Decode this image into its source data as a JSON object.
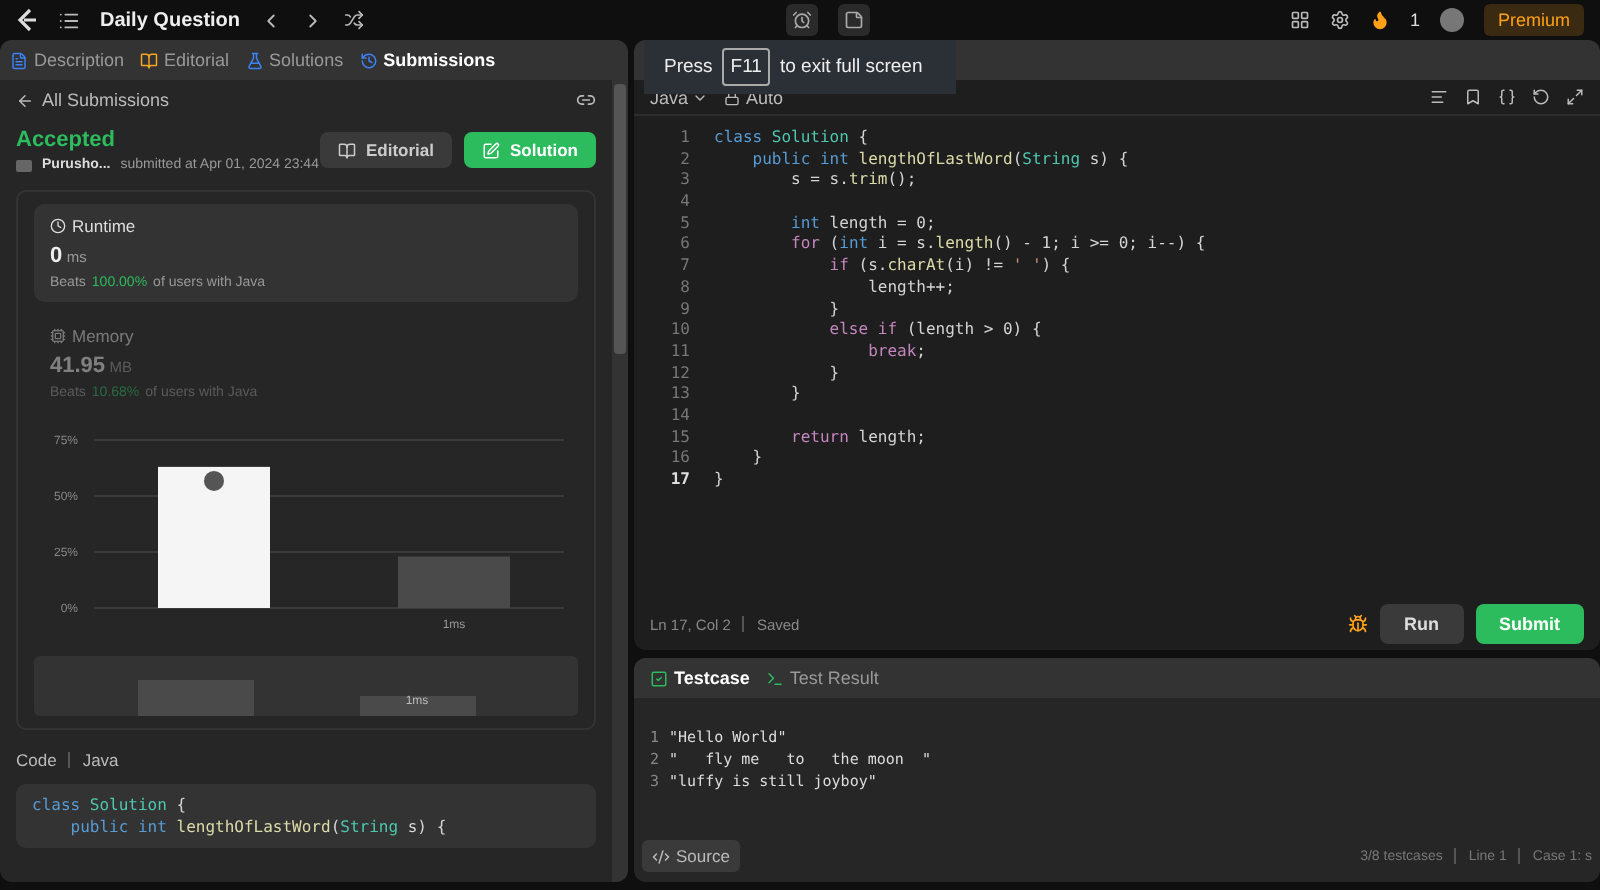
{
  "top_bar": {
    "title": "Daily Question",
    "streak": "1",
    "premium": "Premium"
  },
  "fullscreen_tip": {
    "before": "Press",
    "key": "F11",
    "after": "to exit full screen"
  },
  "tabs": [
    {
      "label": "Description",
      "kind": "description",
      "selected": false
    },
    {
      "label": "Editorial",
      "kind": "editorial",
      "selected": false
    },
    {
      "label": "Solutions",
      "kind": "solutions",
      "selected": false
    },
    {
      "label": "Submissions",
      "kind": "submissions",
      "selected": true
    }
  ],
  "submission": {
    "back": "All Submissions",
    "status": "Accepted",
    "user": "Purusho...",
    "submitted": "submitted at Apr 01, 2024 23:44",
    "buttons": [
      {
        "label": "Editorial",
        "kind": "secondary"
      },
      {
        "label": "Solution",
        "kind": "primary"
      }
    ],
    "stats": [
      {
        "kind": "runtime",
        "title": "Runtime",
        "value": "0",
        "unit": "ms",
        "beats": "Beats",
        "percent": "100.00%",
        "rest": "of users with Java",
        "selected": true
      },
      {
        "kind": "memory",
        "title": "Memory",
        "value": "41.95",
        "unit": "MB",
        "beats": "Beats",
        "percent": "10.68%",
        "rest": "of users with Java",
        "selected": false
      }
    ],
    "chart_data": {
      "type": "bar",
      "values": [
        63,
        23
      ],
      "ylim": [
        0,
        75
      ],
      "yticks": [
        {
          "value": 0,
          "label": "0%"
        },
        {
          "value": 25,
          "label": "25%"
        },
        {
          "value": 50,
          "label": "50%"
        },
        {
          "value": 75,
          "label": "75%"
        }
      ],
      "annotations": [
        "1ms"
      ]
    },
    "overview": {
      "label": "1ms"
    },
    "code_label": "Code",
    "code_lang": "Java",
    "code_preview": [
      {
        "tokens": [
          {
            "text": "class ",
            "kind": "kw"
          },
          {
            "text": "Solution",
            "kind": "type"
          },
          {
            "text": " {",
            "kind": "plain"
          }
        ]
      },
      {
        "tokens": [
          {
            "text": "    public int ",
            "kind": "kw"
          },
          {
            "text": "lengthOfLastWord",
            "kind": "fn"
          },
          {
            "text": "(",
            "kind": "plain"
          },
          {
            "text": "String",
            "kind": "type"
          },
          {
            "text": " s) {",
            "kind": "plain"
          }
        ]
      }
    ]
  },
  "editor": {
    "language": "Java",
    "mode": "Auto",
    "lines": [
      {
        "number": "1",
        "current": false,
        "tokens": [
          {
            "text": "class ",
            "kind": "kw"
          },
          {
            "text": "Solution",
            "kind": "type"
          },
          {
            "text": " {",
            "kind": "plain"
          }
        ]
      },
      {
        "number": "2",
        "current": false,
        "tokens": [
          {
            "text": "    public int ",
            "kind": "kw"
          },
          {
            "text": "lengthOfLastWord",
            "kind": "fn"
          },
          {
            "text": "(",
            "kind": "plain"
          },
          {
            "text": "String",
            "kind": "type"
          },
          {
            "text": " s) {",
            "kind": "plain"
          }
        ]
      },
      {
        "number": "3",
        "current": false,
        "tokens": [
          {
            "text": "        s = s.",
            "kind": "plain"
          },
          {
            "text": "trim",
            "kind": "fn"
          },
          {
            "text": "();",
            "kind": "plain"
          }
        ]
      },
      {
        "number": "4",
        "current": false
      },
      {
        "number": "5",
        "current": false,
        "tokens": [
          {
            "text": "        int ",
            "kind": "kw"
          },
          {
            "text": "length = 0;",
            "kind": "plain"
          }
        ]
      },
      {
        "number": "6",
        "current": false,
        "tokens": [
          {
            "text": "        for ",
            "kind": "ctrl"
          },
          {
            "text": "(",
            "kind": "plain"
          },
          {
            "text": "int ",
            "kind": "kw"
          },
          {
            "text": "i = s.",
            "kind": "plain"
          },
          {
            "text": "length",
            "kind": "fn"
          },
          {
            "text": "() - 1; i >= 0; i--) {",
            "kind": "plain"
          }
        ]
      },
      {
        "number": "7",
        "current": false,
        "tokens": [
          {
            "text": "            if ",
            "kind": "ctrl"
          },
          {
            "text": "(s.",
            "kind": "plain"
          },
          {
            "text": "charAt",
            "kind": "fn"
          },
          {
            "text": "(i) != ",
            "kind": "plain"
          },
          {
            "text": "' '",
            "kind": "str"
          },
          {
            "text": ") {",
            "kind": "plain"
          }
        ]
      },
      {
        "number": "8",
        "current": false,
        "tokens": [
          {
            "text": "                length++;",
            "kind": "plain"
          }
        ]
      },
      {
        "number": "9",
        "current": false,
        "tokens": [
          {
            "text": "            }",
            "kind": "plain"
          }
        ]
      },
      {
        "number": "10",
        "current": false,
        "tokens": [
          {
            "text": "            else if ",
            "kind": "ctrl"
          },
          {
            "text": "(length > 0) {",
            "kind": "plain"
          }
        ]
      },
      {
        "number": "11",
        "current": false,
        "tokens": [
          {
            "text": "                break",
            "kind": "ctrl"
          },
          {
            "text": ";",
            "kind": "plain"
          }
        ]
      },
      {
        "number": "12",
        "current": false,
        "tokens": [
          {
            "text": "            }",
            "kind": "plain"
          }
        ]
      },
      {
        "number": "13",
        "current": false,
        "tokens": [
          {
            "text": "        }",
            "kind": "plain"
          }
        ]
      },
      {
        "number": "14",
        "current": false
      },
      {
        "number": "15",
        "current": false,
        "tokens": [
          {
            "text": "        return ",
            "kind": "ctrl"
          },
          {
            "text": "length;",
            "kind": "plain"
          }
        ]
      },
      {
        "number": "16",
        "current": false,
        "tokens": [
          {
            "text": "    }",
            "kind": "plain"
          }
        ]
      },
      {
        "number": "17",
        "current": true,
        "tokens": [
          {
            "text": "}",
            "kind": "plain"
          }
        ]
      }
    ],
    "position": "Ln 17, Col 2",
    "saved": "Saved",
    "run": "Run",
    "submit": "Submit"
  },
  "testcase_panel": {
    "tabs": [
      {
        "label": "Testcase",
        "kind": "testcase",
        "selected": true
      },
      {
        "label": "Test Result",
        "kind": "result",
        "selected": false
      }
    ],
    "lines": [
      {
        "number": "1",
        "text": "\"Hello World\""
      },
      {
        "number": "2",
        "text": "\"   fly me   to   the moon  \""
      },
      {
        "number": "3",
        "text": "\"luffy is still joyboy\""
      }
    ],
    "source": "Source",
    "count": "3/8 testcases",
    "line": "Line 1",
    "case": "Case 1: s"
  }
}
